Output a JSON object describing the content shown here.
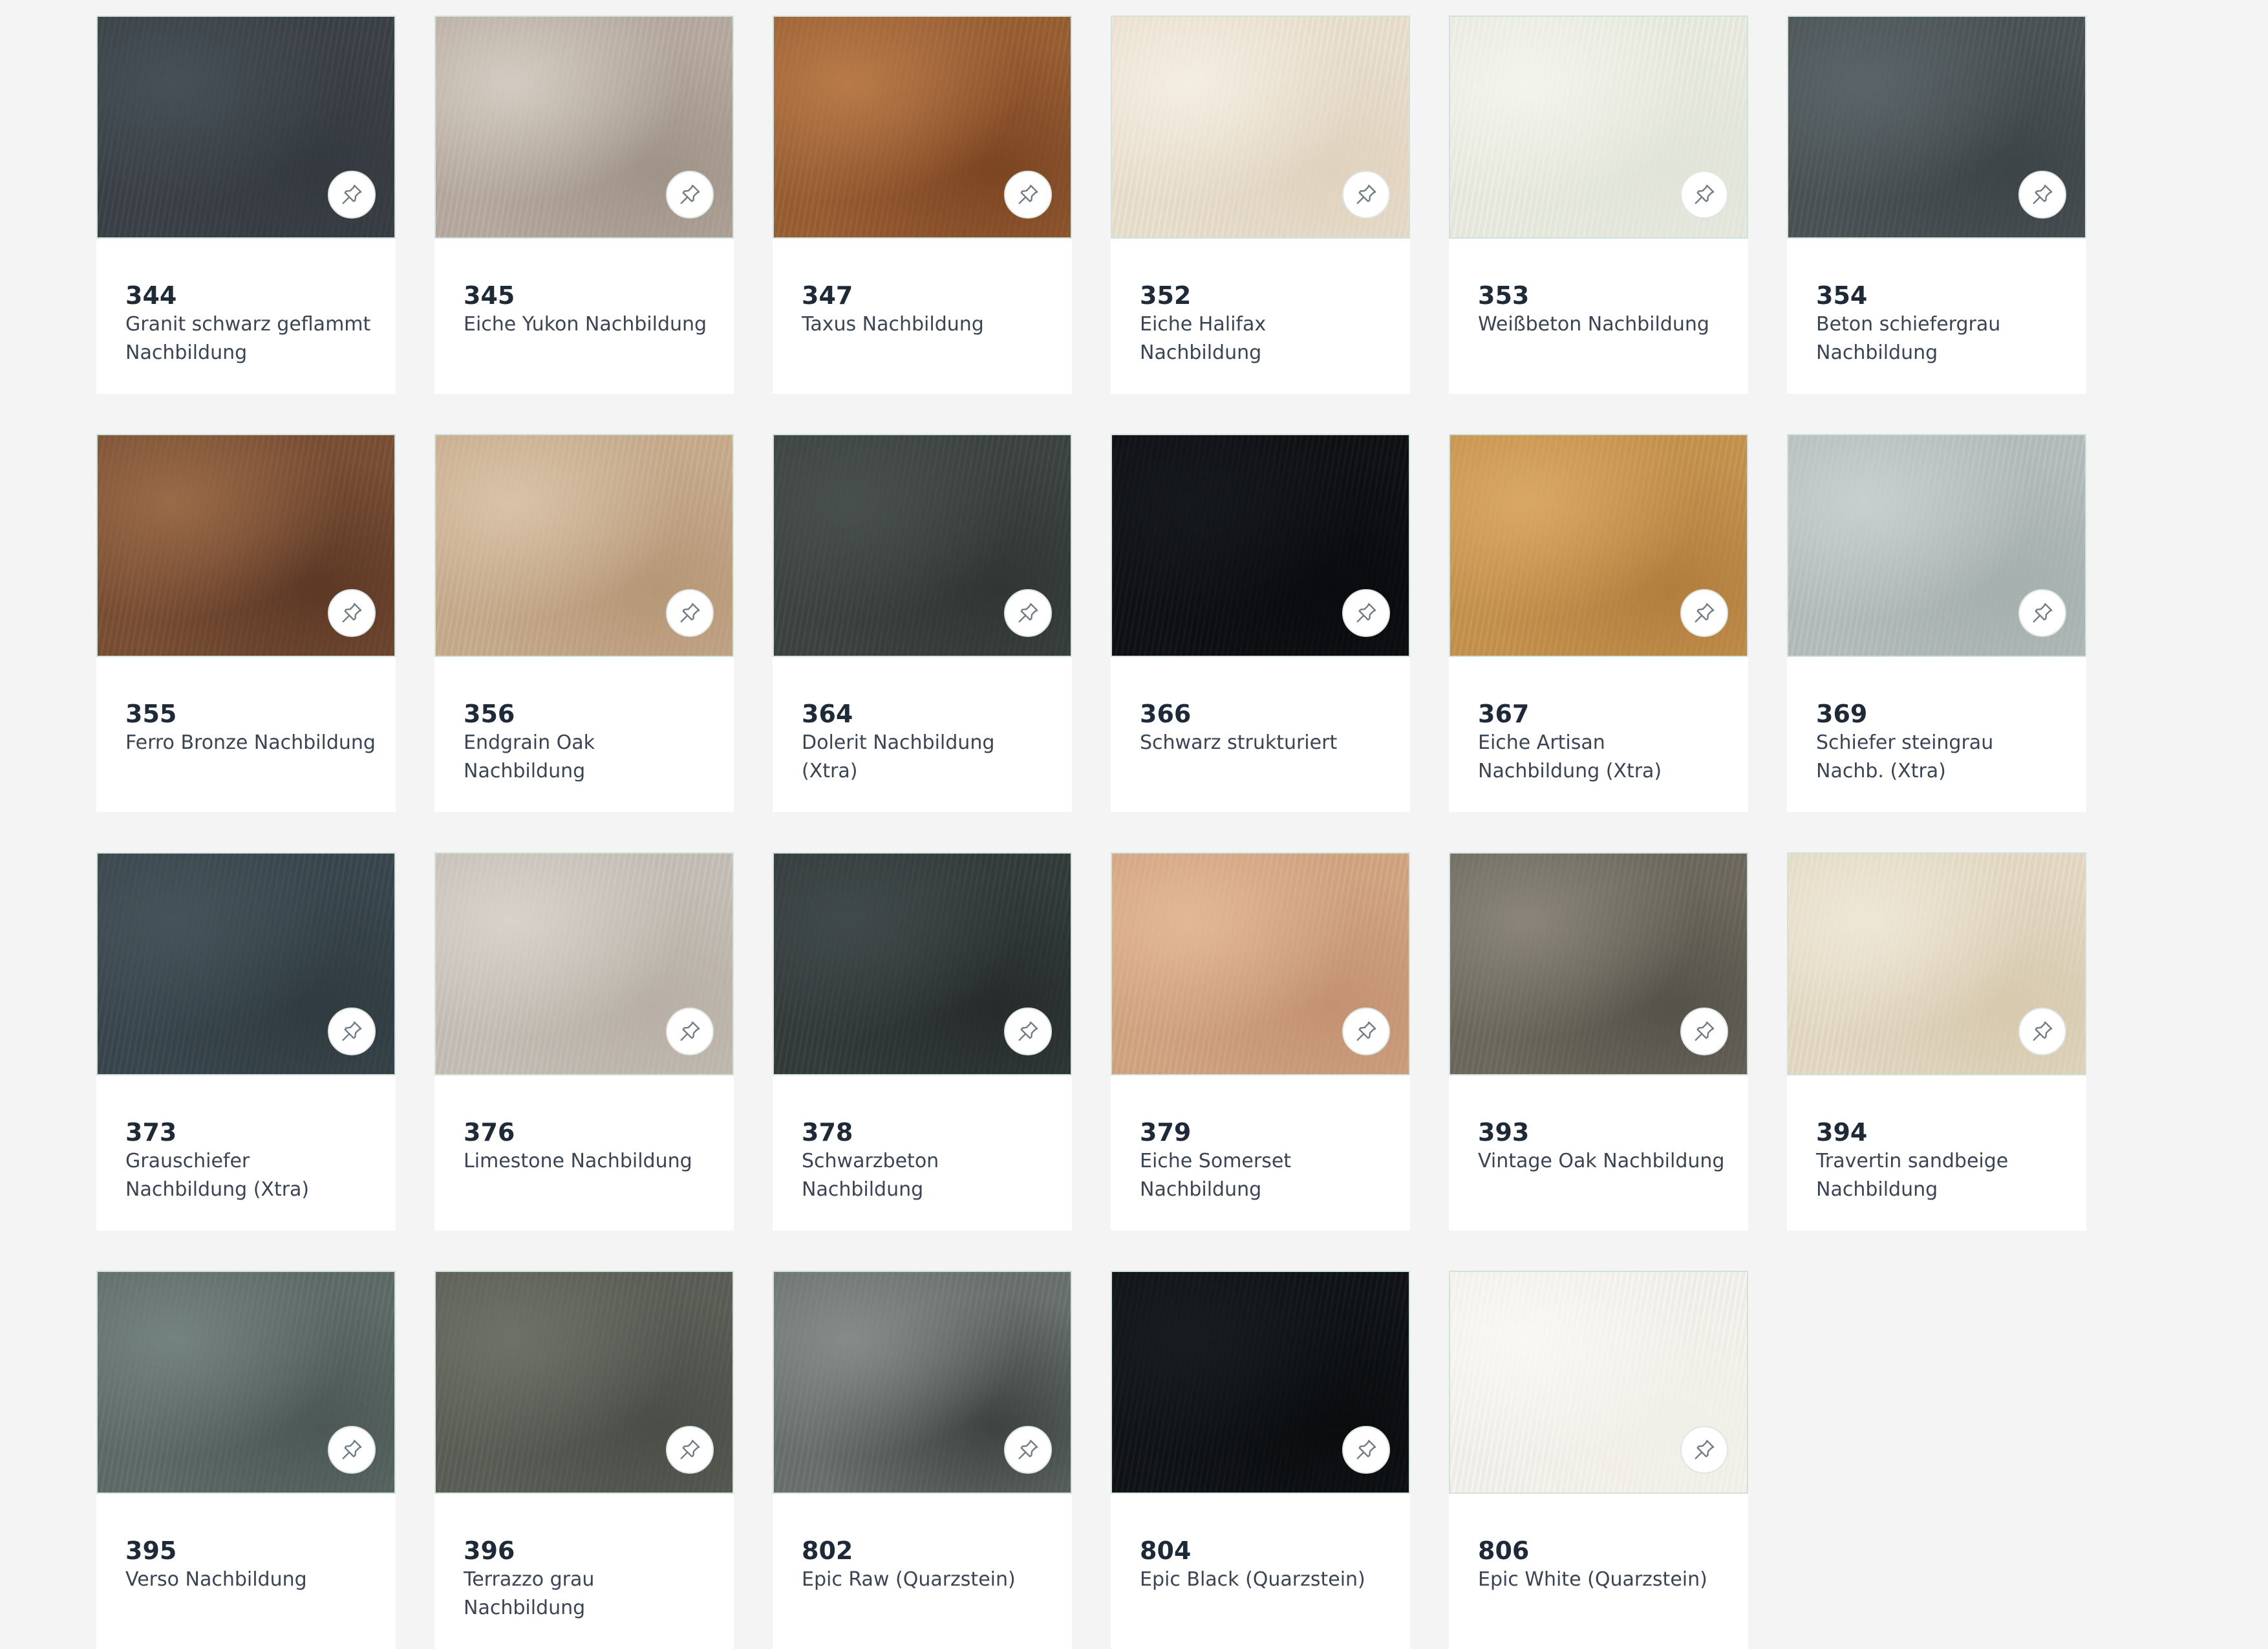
{
  "colors": {
    "page_background": "#f3f4f3",
    "card_background": "#ffffff",
    "swatch_border": "#cfe3da",
    "number_text": "#1e2a38",
    "label_text": "#3a4452"
  },
  "items": [
    {
      "number": "344",
      "name": "Granit schwarz geflammt Nachbildung",
      "colors": [
        "#3b4147",
        "#465057",
        "#333a40"
      ],
      "icon": "pushpin-icon"
    },
    {
      "number": "345",
      "name": "Eiche Yukon Nachbildung",
      "colors": [
        "#b8aca2",
        "#d3cbc1",
        "#9f9388"
      ],
      "icon": "pushpin-icon"
    },
    {
      "number": "347",
      "name": "Taxus Nachbildung",
      "colors": [
        "#9a5f34",
        "#b87a48",
        "#7c4522"
      ],
      "icon": "pushpin-icon"
    },
    {
      "number": "352",
      "name": "Eiche Halifax Nachbildung",
      "colors": [
        "#ece2d1",
        "#f4ede1",
        "#e0d3be"
      ],
      "icon": "pushpin-icon"
    },
    {
      "number": "353",
      "name": "Weißbeton Nachbildung",
      "colors": [
        "#eceee3",
        "#f3f4ec",
        "#e1e4d8"
      ],
      "icon": "pushpin-icon"
    },
    {
      "number": "354",
      "name": "Beton schiefergrau Nachbildung",
      "colors": [
        "#4b5356",
        "#5b6568",
        "#3d4447"
      ],
      "icon": "pushpin-icon"
    },
    {
      "number": "355",
      "name": "Ferro Bronze Nachbildung",
      "colors": [
        "#7a4f34",
        "#9a6a48",
        "#5c3825"
      ],
      "icon": "pushpin-icon"
    },
    {
      "number": "356",
      "name": "Endgrain Oak Nachbildung",
      "colors": [
        "#c9ad8e",
        "#d9c2a6",
        "#b69777"
      ],
      "icon": "pushpin-icon"
    },
    {
      "number": "364",
      "name": "Dolerit Nachbildung (Xtra)",
      "colors": [
        "#3c4341",
        "#48504e",
        "#303634"
      ],
      "icon": "pushpin-icon"
    },
    {
      "number": "366",
      "name": "Schwarz strukturiert",
      "colors": [
        "#0e1014",
        "#15181d",
        "#090b0e"
      ],
      "icon": "pushpin-icon"
    },
    {
      "number": "367",
      "name": "Eiche Artisan Nachbildung (Xtra)",
      "colors": [
        "#c8944f",
        "#d9a862",
        "#b27e3e"
      ],
      "icon": "pushpin-icon"
    },
    {
      "number": "369",
      "name": "Schiefer steingrau Nachb. (Xtra)",
      "colors": [
        "#b6c0bf",
        "#c7d0cf",
        "#a5afae"
      ],
      "icon": "pushpin-icon"
    },
    {
      "number": "373",
      "name": "Grauschiefer Nachbildung (Xtra)",
      "colors": [
        "#3a474e",
        "#45535a",
        "#2f3b41"
      ],
      "icon": "pushpin-icon"
    },
    {
      "number": "376",
      "name": "Limestone Nachbildung",
      "colors": [
        "#c8c1b8",
        "#d8d2ca",
        "#b8b0a6"
      ],
      "icon": "pushpin-icon"
    },
    {
      "number": "378",
      "name": "Schwarzbeton Nachbildung",
      "colors": [
        "#333b3b",
        "#414a4a",
        "#262c2c"
      ],
      "icon": "pushpin-icon"
    },
    {
      "number": "379",
      "name": "Eiche Somerset Nachbildung",
      "colors": [
        "#d5a683",
        "#e1b897",
        "#c39272"
      ],
      "icon": "pushpin-icon"
    },
    {
      "number": "393",
      "name": "Vintage Oak Nachbildung",
      "colors": [
        "#6e6a5e",
        "#8a857a",
        "#55524a"
      ],
      "icon": "pushpin-icon"
    },
    {
      "number": "394",
      "name": "Travertin sandbeige Nachbildung",
      "colors": [
        "#e6dcc6",
        "#efe7d6",
        "#d6c9ae"
      ],
      "icon": "pushpin-icon"
    },
    {
      "number": "395",
      "name": "Verso Nachbildung",
      "colors": [
        "#5f6c69",
        "#748280",
        "#4c5856"
      ],
      "icon": "pushpin-icon"
    },
    {
      "number": "396",
      "name": "Terrazzo grau Nachbildung",
      "colors": [
        "#5b5f56",
        "#6d7167",
        "#4a4e46"
      ],
      "icon": "pushpin-icon"
    },
    {
      "number": "802",
      "name": "Epic Raw (Quarzstein)",
      "colors": [
        "#6b716e",
        "#858b88",
        "#3e4341"
      ],
      "icon": "pushpin-icon"
    },
    {
      "number": "804",
      "name": "Epic Black (Quarzstein)",
      "colors": [
        "#101316",
        "#181c20",
        "#0a0c0e"
      ],
      "icon": "pushpin-icon"
    },
    {
      "number": "806",
      "name": "Epic White (Quarzstein)",
      "colors": [
        "#f6f5ee",
        "#f9f8f3",
        "#f1f0e8"
      ],
      "icon": "pushpin-icon"
    }
  ]
}
